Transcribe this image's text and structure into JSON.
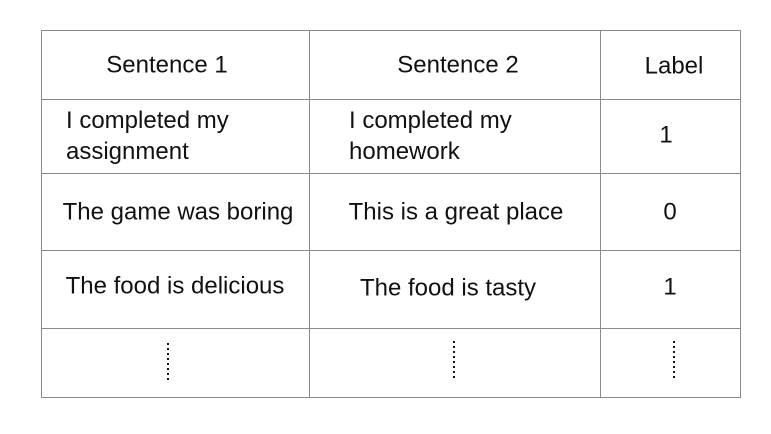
{
  "table": {
    "headers": [
      "Sentence 1",
      "Sentence 2",
      "Label"
    ],
    "rows": [
      {
        "sentence1": "I completed my\nassignment",
        "sentence2": "I completed my\nhomework",
        "label": "1"
      },
      {
        "sentence1": "The game was boring",
        "sentence2": "This is a great place",
        "label": "0"
      },
      {
        "sentence1": "The food is delicious",
        "sentence2": "The food is tasty",
        "label": "1"
      }
    ]
  },
  "colors": {
    "border": "#8a8a8a",
    "text": "#111111",
    "background": "#ffffff"
  }
}
